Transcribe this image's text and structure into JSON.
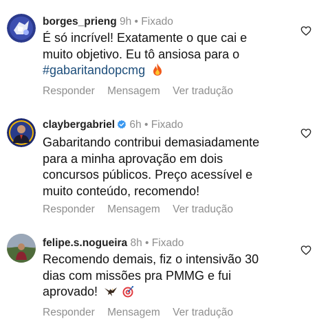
{
  "comments": [
    {
      "username": "borges_prieng",
      "time": "9h",
      "separator": "•",
      "pinned": "Fixado",
      "verified": false,
      "text_lines": [
        "É só incrível! Exatamente o que cai e",
        "muito objetivo. Eu tô ansiosa para o"
      ],
      "hashtag": "#gabaritandopcmg",
      "emoji": "fire-emoji",
      "actions": [
        "Responder",
        "Mensagem",
        "Ver tradução"
      ],
      "like_icon": "heart-outline-icon"
    },
    {
      "username": "claybergabriel",
      "time": "6h",
      "separator": "•",
      "pinned": "Fixado",
      "verified": true,
      "text_lines": [
        "Gabaritando contribui demasiadamente",
        "para a minha aprovação em dois",
        "concursos públicos. Preço acessível e",
        "muito conteúdo, recomendo!"
      ],
      "actions": [
        "Responder",
        "Mensagem",
        "Ver tradução"
      ],
      "like_icon": "heart-outline-icon"
    },
    {
      "username": "felipe.s.nogueira",
      "time": "8h",
      "separator": "•",
      "pinned": "Fixado",
      "verified": false,
      "text_lines": [
        "Recomendo demais, fiz o intensivão 30",
        "dias com missões pra PMMG e fui",
        "aprovado!"
      ],
      "emojis": [
        "eagle-emoji",
        "target-emoji"
      ],
      "actions": [
        "Responder",
        "Mensagem",
        "Ver tradução"
      ],
      "like_icon": "heart-outline-icon"
    }
  ],
  "colors": {
    "meta_gray": "#8e8e8e",
    "hashtag": "#1c4d7a",
    "verified_blue": "#3897f0"
  }
}
